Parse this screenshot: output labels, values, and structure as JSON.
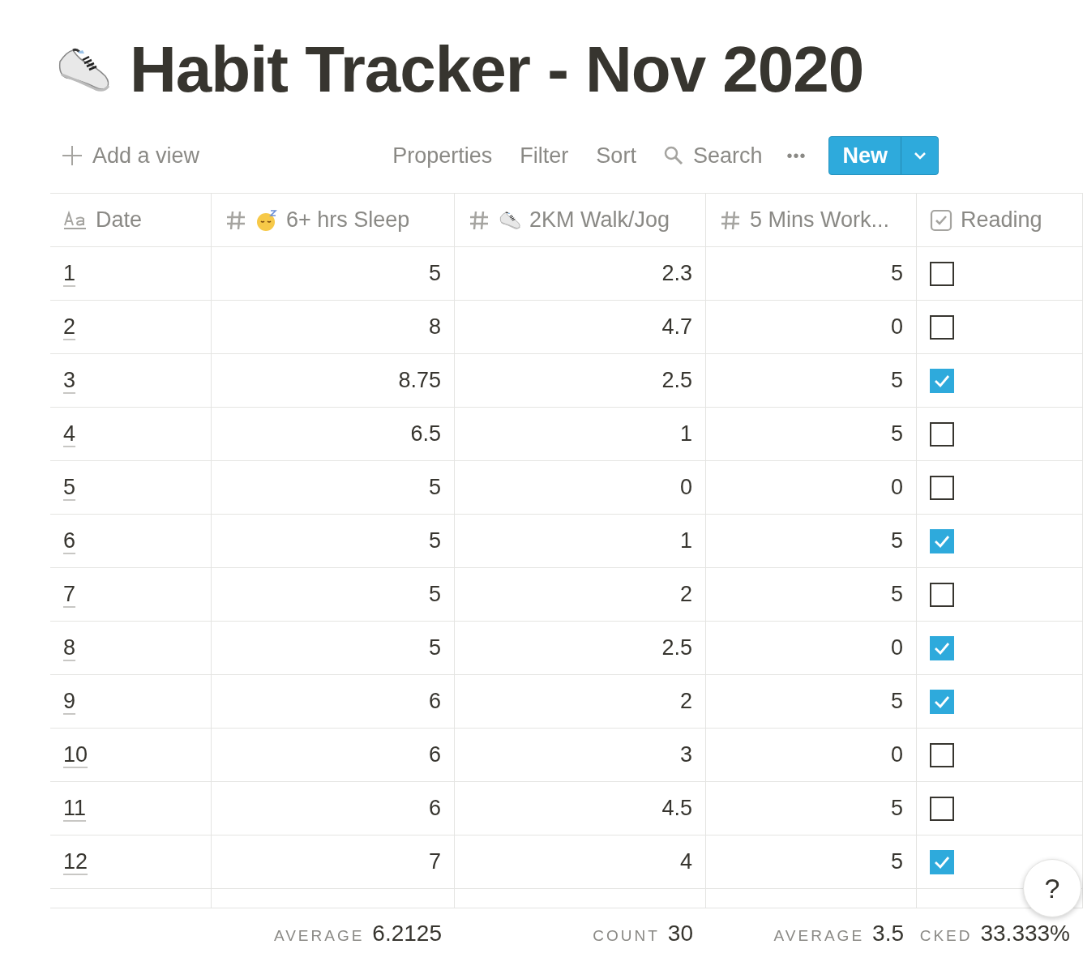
{
  "title": "Habit Tracker - Nov 2020",
  "toolbar": {
    "add_view": "Add a view",
    "actions": [
      "Properties",
      "Filter",
      "Sort"
    ],
    "search": "Search",
    "more": "•••",
    "new_button": "New"
  },
  "columns": [
    {
      "kind": "title",
      "label": "Date"
    },
    {
      "kind": "number",
      "label": "6+ hrs Sleep"
    },
    {
      "kind": "number",
      "label": "2KM Walk/Jog"
    },
    {
      "kind": "number",
      "label": "5 Mins Work..."
    },
    {
      "kind": "checkbox",
      "label": "Reading"
    }
  ],
  "rows": [
    {
      "date": "1",
      "sleep": "5",
      "walk": "2.3",
      "workout": "5",
      "reading": false
    },
    {
      "date": "2",
      "sleep": "8",
      "walk": "4.7",
      "workout": "0",
      "reading": false
    },
    {
      "date": "3",
      "sleep": "8.75",
      "walk": "2.5",
      "workout": "5",
      "reading": true
    },
    {
      "date": "4",
      "sleep": "6.5",
      "walk": "1",
      "workout": "5",
      "reading": false
    },
    {
      "date": "5",
      "sleep": "5",
      "walk": "0",
      "workout": "0",
      "reading": false
    },
    {
      "date": "6",
      "sleep": "5",
      "walk": "1",
      "workout": "5",
      "reading": true
    },
    {
      "date": "7",
      "sleep": "5",
      "walk": "2",
      "workout": "5",
      "reading": false
    },
    {
      "date": "8",
      "sleep": "5",
      "walk": "2.5",
      "workout": "0",
      "reading": true
    },
    {
      "date": "9",
      "sleep": "6",
      "walk": "2",
      "workout": "5",
      "reading": true
    },
    {
      "date": "10",
      "sleep": "6",
      "walk": "3",
      "workout": "0",
      "reading": false
    },
    {
      "date": "11",
      "sleep": "6",
      "walk": "4.5",
      "workout": "5",
      "reading": false
    },
    {
      "date": "12",
      "sleep": "7",
      "walk": "4",
      "workout": "5",
      "reading": true
    }
  ],
  "footer": [
    {
      "label": "AVERAGE",
      "value": "6.2125"
    },
    {
      "label": "COUNT",
      "value": "30"
    },
    {
      "label": "AVERAGE",
      "value": "3.5"
    },
    {
      "label": "CKED",
      "value": "33.333%"
    }
  ],
  "help_button": "?"
}
